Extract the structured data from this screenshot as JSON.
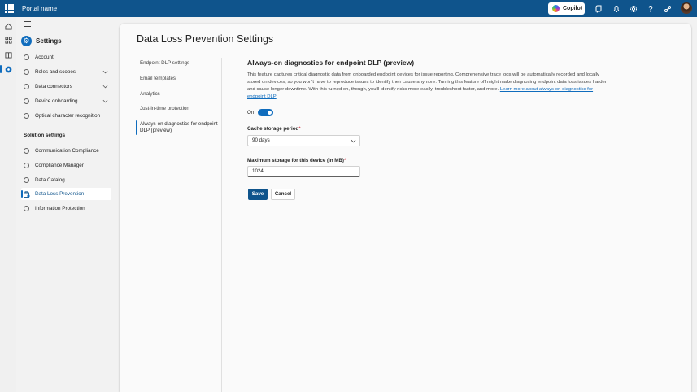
{
  "header": {
    "portal_name": "Portal name",
    "copilot_label": "Copilot",
    "icons": [
      "app-launcher-icon",
      "feedback-icon",
      "bell-icon",
      "gear-icon",
      "help-icon",
      "share-icon",
      "avatar"
    ]
  },
  "rail": {
    "items": [
      "home-icon",
      "apps-icon",
      "book-icon",
      "settings-icon"
    ]
  },
  "nav": {
    "title": "Settings",
    "items": [
      {
        "label": "Account",
        "has_chevron": false
      },
      {
        "label": "Roles and scopes",
        "has_chevron": true
      },
      {
        "label": "Data connectors",
        "has_chevron": true
      },
      {
        "label": "Device onboarding",
        "has_chevron": true
      },
      {
        "label": "Optical character recognition",
        "has_chevron": false
      }
    ],
    "section_label": "Solution settings",
    "solution_items": [
      {
        "label": "Communication Compliance"
      },
      {
        "label": "Compliance Manager"
      },
      {
        "label": "Data Catalog"
      },
      {
        "label": "Data Loss Prevention",
        "active": true
      },
      {
        "label": "Information Protection"
      }
    ]
  },
  "page": {
    "title": "Data Loss Prevention Settings",
    "subnav": [
      {
        "label": "Endpoint DLP settings"
      },
      {
        "label": "Email templates"
      },
      {
        "label": "Analytics"
      },
      {
        "label": "Just-in-time protection"
      },
      {
        "label": "Always-on diagnostics for endpoint DLP (preview)",
        "active": true
      }
    ]
  },
  "content": {
    "section_title": "Always-on diagnostics for endpoint DLP (preview)",
    "description": "This feature captures critical diagnostic data from onboarded endpoint devices for issue reporting. Comprehensive trace logs will be automatically recorded and locally stored on devices, so you won't have to reproduce issues to identify their cause anymore. Turning this feature off might make diagnosing endpoint data loss issues harder and cause longer downtime. With this turned on, though, you'll identify risks more easily, troubleshoot faster, and more.",
    "learn_more_link": "Learn more about always-on diagnostics for endpoint DLP",
    "toggle_label": "On",
    "toggle_on": true,
    "cache_label": "Cache storage period",
    "cache_value": "90 days",
    "max_storage_label": "Maximum storage for this device (in MB)",
    "max_storage_value": "1024",
    "required_mark": "*",
    "save_label": "Save",
    "cancel_label": "Cancel"
  },
  "colors": {
    "header_bg": "#0f548c",
    "accent": "#0f6cbd",
    "required": "#c50f1f"
  }
}
